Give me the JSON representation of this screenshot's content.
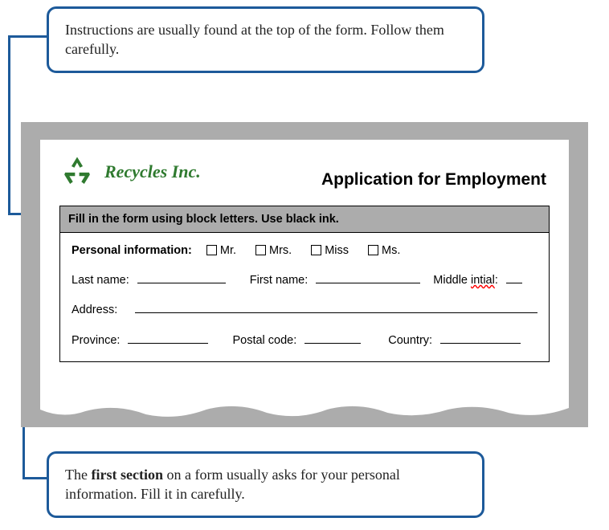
{
  "callouts": {
    "top": "Instructions are usually found at the top of the form. Follow them carefully.",
    "bottom_pre": "The ",
    "bottom_bold": "first section",
    "bottom_post": " on a form usually asks for your personal information. Fill it in carefully."
  },
  "form": {
    "brand": "Recycles Inc.",
    "title": "Application for Employment",
    "instruction": "Fill in the form using block letters. Use black ink.",
    "section_label": "Personal  information:",
    "titles": [
      "Mr.",
      "Mrs.",
      "Miss",
      "Ms."
    ],
    "labels": {
      "last_name": "Last name:",
      "first_name": "First name:",
      "middle_initial": "Middle ",
      "middle_initial_err": "intial",
      "middle_initial_suffix": ":",
      "address": "Address:",
      "province": "Province:",
      "postal": "Postal code:",
      "country": "Country:"
    }
  }
}
